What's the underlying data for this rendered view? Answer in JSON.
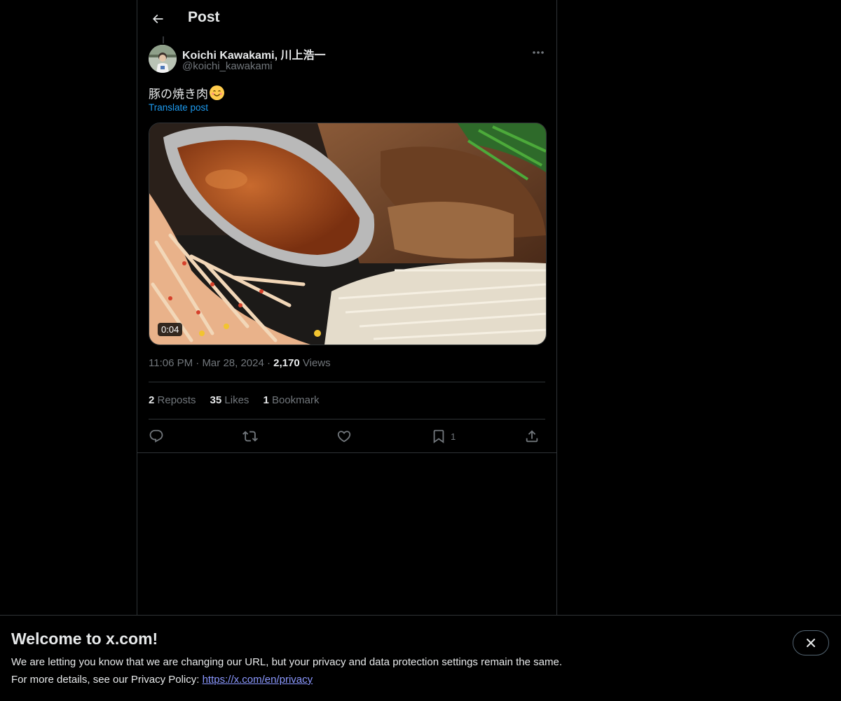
{
  "header": {
    "title": "Post"
  },
  "author": {
    "name": "Koichi Kawakami, 川上浩一",
    "handle": "@koichi_kawakami"
  },
  "post": {
    "text": "豚の焼き肉",
    "emoji": "smiling-face-emoji",
    "translate_label": "Translate post",
    "video_duration": "0:04",
    "media_description_icon": "video-thumbnail"
  },
  "meta": {
    "time": "11:06 PM",
    "separator": "·",
    "date": "Mar 28, 2024",
    "views_count": "2,170",
    "views_label": "Views"
  },
  "stats": {
    "reposts_count": "2",
    "reposts_label": "Reposts",
    "likes_count": "35",
    "likes_label": "Likes",
    "bookmarks_count": "1",
    "bookmarks_label": "Bookmark"
  },
  "actions": {
    "reply_icon": "reply-icon",
    "repost_icon": "repost-icon",
    "like_icon": "heart-icon",
    "bookmark_icon": "bookmark-icon",
    "bookmark_count": "1",
    "share_icon": "share-icon"
  },
  "banner": {
    "title": "Welcome to x.com!",
    "line1": "We are letting you know that we are changing our URL, but your privacy and data protection settings remain the same.",
    "line2_prefix": "For more details, see our Privacy Policy: ",
    "link": "https://x.com/en/privacy"
  },
  "colors": {
    "background": "#000000",
    "text": "#e7e9ea",
    "muted": "#71767b",
    "accent": "#1d9bf0",
    "border": "#2f3336"
  }
}
